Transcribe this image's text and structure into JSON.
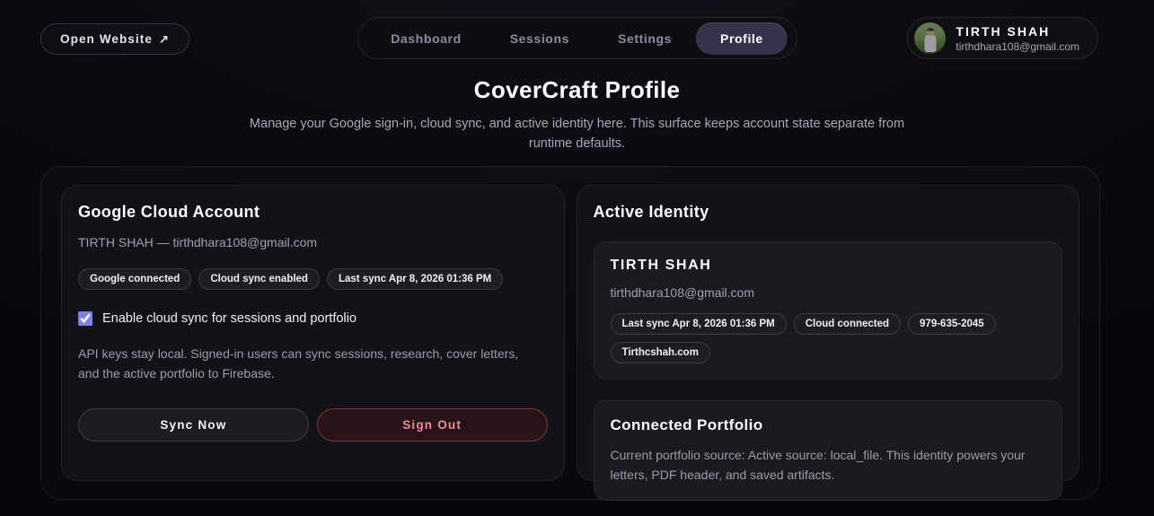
{
  "page": {
    "title": "CoverCraft Profile",
    "subtitle": "Manage your Google sign-in, cloud sync, and active identity here. This surface keeps account state separate from runtime defaults."
  },
  "header": {
    "open_website": {
      "label": "Open Website",
      "arrow": "↗"
    },
    "nav": [
      {
        "label": "Dashboard",
        "active": false
      },
      {
        "label": "Sessions",
        "active": false
      },
      {
        "label": "Settings",
        "active": false
      },
      {
        "label": "Profile",
        "active": true
      }
    ],
    "user": {
      "name": "TIRTH SHAH",
      "email": "tirthdhara108@gmail.com",
      "avatar": "photo-of-user-outdoors"
    }
  },
  "google_card": {
    "title": "Google Cloud Account",
    "account_line": "TIRTH SHAH — tirthdhara108@gmail.com",
    "badges": [
      "Google connected",
      "Cloud sync enabled",
      "Last sync Apr 8, 2026 01:36 PM"
    ],
    "checkbox": {
      "label": "Enable cloud sync for sessions and portfolio",
      "checked": true
    },
    "description": "API keys stay local. Signed-in users can sync sessions, research, cover letters, and the active portfolio to Firebase.",
    "sync_button_label": "Sync Now",
    "signout_button_label": "Sign Out"
  },
  "identity_card": {
    "title": "Active Identity",
    "profile": {
      "name": "TIRTH SHAH",
      "email": "tirthdhara108@gmail.com",
      "badges": [
        "Last sync Apr 8, 2026 01:36 PM",
        "Cloud connected",
        "979-635-2045",
        "Tirthcshah.com"
      ]
    },
    "portfolio": {
      "title": "Connected Portfolio",
      "description": "Current portfolio source: Active source: local_file. This identity powers your letters, PDF header, and saved artifacts."
    }
  },
  "colors": {
    "background": "#07070b",
    "card": "#121218",
    "inner_card": "#1a1a21",
    "active_nav_pill": "#37324a",
    "checkbox_accent": "#7e81ea",
    "signout_text": "#ef8d92",
    "signout_background": "#271318",
    "muted_text": "#9b9ca9"
  }
}
